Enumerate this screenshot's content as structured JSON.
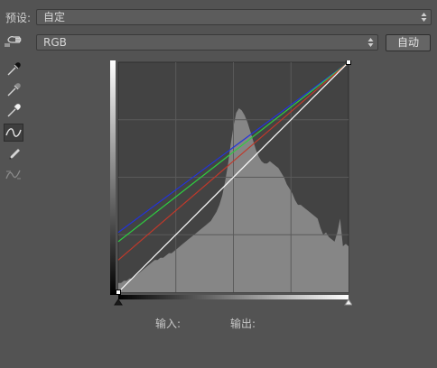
{
  "preset": {
    "label": "预设:",
    "value": "自定"
  },
  "channel": {
    "value": "RGB",
    "auto_label": "自动"
  },
  "tools": [
    {
      "name": "targeted-adjustment-hand-icon"
    },
    {
      "name": "sample-black-point-eyedropper-icon"
    },
    {
      "name": "sample-gray-point-eyedropper-icon"
    },
    {
      "name": "sample-white-point-eyedropper-icon"
    },
    {
      "name": "edit-points-curve-icon"
    },
    {
      "name": "draw-pencil-icon"
    },
    {
      "name": "smooth-curve-icon"
    }
  ],
  "curve": {
    "input_label": "输入:",
    "output_label": "输出:",
    "colors": {
      "red": "#c0392b",
      "green": "#2ecc40",
      "blue": "#2233dd",
      "composite": "#ffffff"
    },
    "red_start": 0.14,
    "green_start": 0.22,
    "blue_start": 0.26,
    "histogram": [
      4,
      4,
      5,
      5,
      6,
      6,
      7,
      8,
      9,
      10,
      11,
      12,
      13,
      14,
      14,
      15,
      15,
      16,
      17,
      17,
      18,
      19,
      20,
      21,
      22,
      23,
      24,
      25,
      26,
      27,
      28,
      29,
      30,
      31,
      33,
      35,
      38,
      42,
      48,
      55,
      64,
      72,
      78,
      80,
      79,
      77,
      74,
      70,
      66,
      62,
      59,
      57,
      56,
      56,
      57,
      56,
      55,
      54,
      52,
      50,
      47,
      45,
      43,
      40,
      38,
      38,
      37,
      36,
      35,
      34,
      33,
      32,
      28,
      25,
      26,
      24,
      23,
      22,
      26,
      32,
      20,
      21,
      20
    ]
  }
}
